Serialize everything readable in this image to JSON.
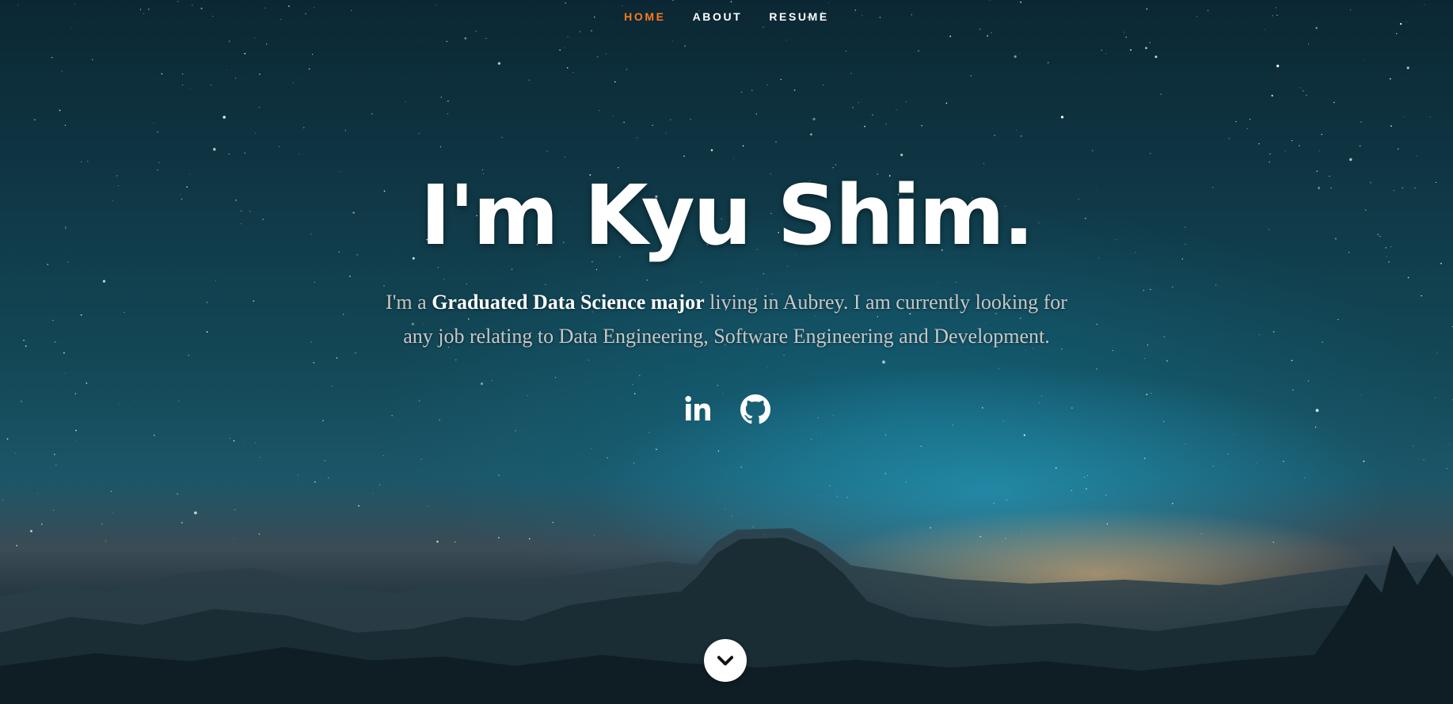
{
  "nav": {
    "items": [
      {
        "label": "HOME",
        "active": true
      },
      {
        "label": "ABOUT",
        "active": false
      },
      {
        "label": "RESUME",
        "active": false
      }
    ]
  },
  "hero": {
    "title": "I'm Kyu Shim.",
    "description_prefix": "I'm a ",
    "description_highlight": "Graduated Data Science major",
    "description_suffix": " living in Aubrey. I am currently looking for any job relating to Data Engineering, Software Engineering and Development."
  },
  "social": [
    {
      "icon": "linkedin-icon"
    },
    {
      "icon": "github-icon"
    }
  ],
  "scroll": {
    "icon": "chevron-down-icon"
  },
  "colors": {
    "accent": "#ff7a1a",
    "text_primary": "#ffffff",
    "text_secondary": "#c6c8c8"
  }
}
